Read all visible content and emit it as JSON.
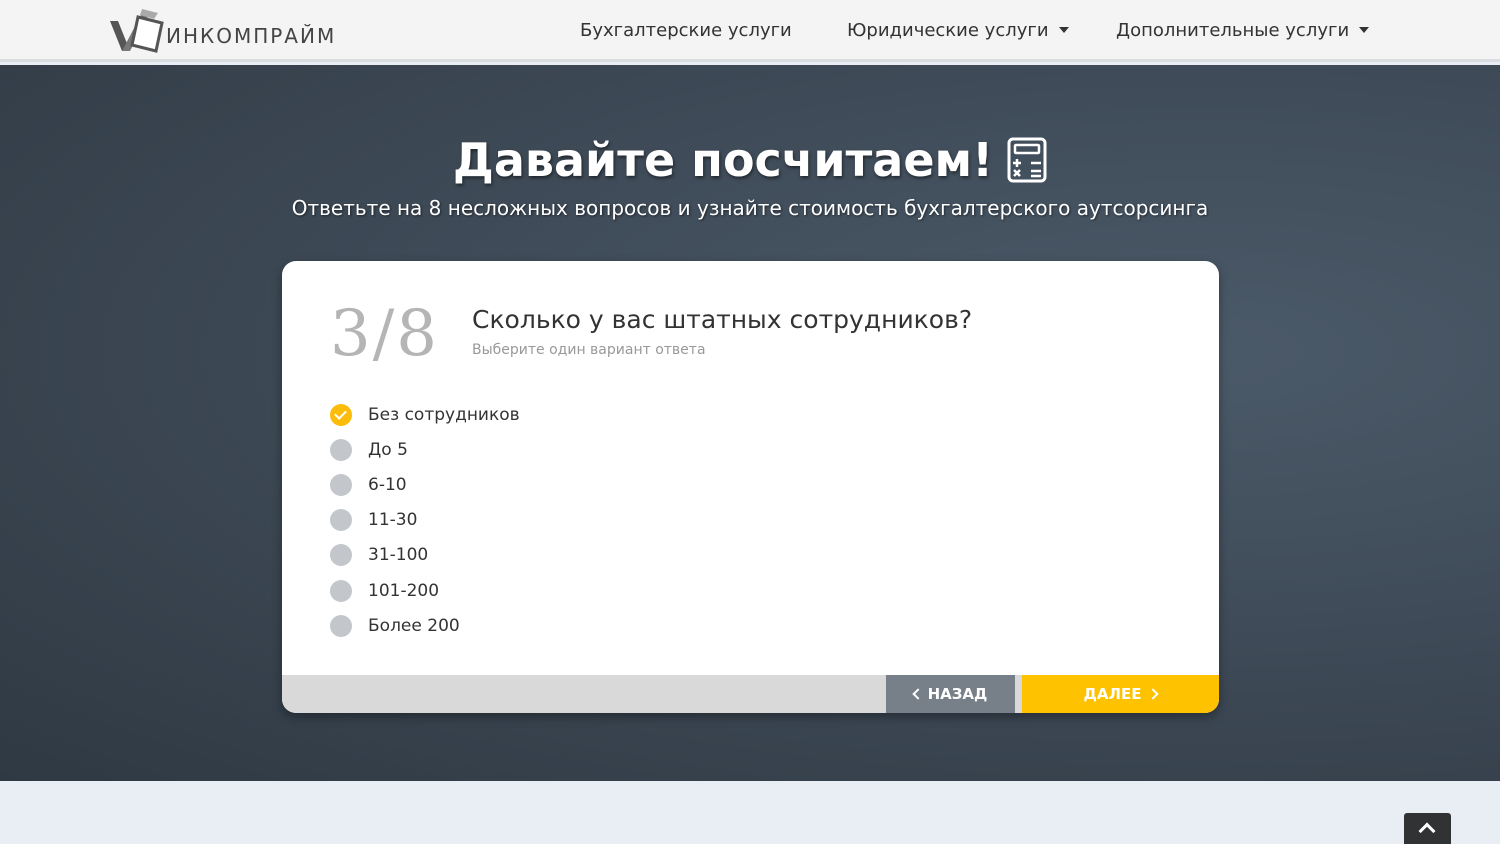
{
  "header": {
    "logo_text": "ИНКОМПРАЙМ",
    "nav": [
      {
        "label": "Бухгалтерские услуги",
        "has_dropdown": false
      },
      {
        "label": "Юридические услуги",
        "has_dropdown": true
      },
      {
        "label": "Дополнительные услуги",
        "has_dropdown": true
      }
    ]
  },
  "hero": {
    "title": "Давайте посчитаем!",
    "subtitle": "Ответьте на 8 несложных вопросов и узнайте стоимость бухгалтерского аутсорсинга",
    "icon": "calculator-icon"
  },
  "quiz": {
    "step": "3/8",
    "question": "Сколько у вас штатных сотрудников?",
    "hint": "Выберите один вариант ответа",
    "options": [
      {
        "label": "Без сотрудников",
        "selected": true
      },
      {
        "label": "До 5",
        "selected": false
      },
      {
        "label": "6-10",
        "selected": false
      },
      {
        "label": "11-30",
        "selected": false
      },
      {
        "label": "31-100",
        "selected": false
      },
      {
        "label": "101-200",
        "selected": false
      },
      {
        "label": "Более 200",
        "selected": false
      }
    ],
    "back_label": "НАЗАД",
    "next_label": "ДАЛЕЕ"
  },
  "colors": {
    "accent": "#fec200",
    "back_button": "#777f88",
    "hero_bg": "#3f4b58"
  }
}
